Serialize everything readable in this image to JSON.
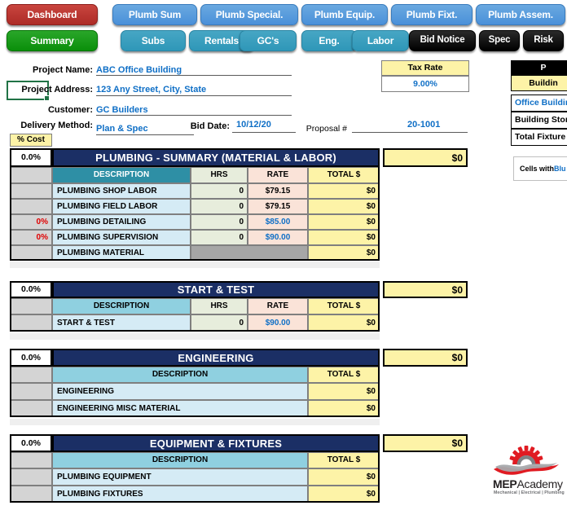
{
  "nav": {
    "row1": [
      {
        "label": "Dashboard",
        "style": "red"
      },
      {
        "label": "Plumb Sum",
        "style": "blue"
      },
      {
        "label": "Plumb Special.",
        "style": "blue"
      },
      {
        "label": "Plumb Equip.",
        "style": "blue"
      },
      {
        "label": "Plumb Fixt.",
        "style": "blue"
      },
      {
        "label": "Plumb Assem.",
        "style": "blue"
      }
    ],
    "row2": [
      {
        "label": "Summary",
        "style": "green"
      },
      {
        "label": "Subs",
        "style": "teal"
      },
      {
        "label": "Rentals",
        "style": "teal"
      },
      {
        "label": "GC's",
        "style": "teal"
      },
      {
        "label": "Eng.",
        "style": "teal"
      },
      {
        "label": "Labor",
        "style": "teal"
      },
      {
        "label": "Bid Notice",
        "style": "black"
      },
      {
        "label": "Spec",
        "style": "black"
      },
      {
        "label": "Risk",
        "style": "black"
      }
    ]
  },
  "project": {
    "name_label": "Project Name:",
    "name_value": "ABC Office Building",
    "address_label": "Project Address:",
    "address_value": "123 Any Street, City, State",
    "customer_label": "Customer:",
    "customer_value": "GC Builders",
    "delivery_label": "Delivery Method:",
    "delivery_value": "Plan & Spec",
    "bid_date_label": "Bid Date:",
    "bid_date_value": "10/12/20",
    "proposal_label": "Proposal #",
    "proposal_value": "20-1001"
  },
  "tax": {
    "header": "Tax Rate",
    "value": "9.00%"
  },
  "pct_cost_label": "% Cost",
  "right_panel": {
    "title": "P",
    "subtitle": "Buildin",
    "rows": [
      {
        "label": "Office Buildin",
        "blue": true
      },
      {
        "label": "Building Stori",
        "blue": false
      },
      {
        "label": "Total Fixture ",
        "blue": false
      }
    ],
    "note_plain": "Cells with ",
    "note_blue": "Blu"
  },
  "sections": [
    {
      "pct": "0.0%",
      "title": "PLUMBING - SUMMARY (MATERIAL & LABOR)",
      "grand_total": "$0",
      "columns": [
        "DESCRIPTION",
        "HRS",
        "RATE",
        "TOTAL $"
      ],
      "has_hrs_rate": true,
      "desc_header_style": "teal",
      "rows": [
        {
          "pct": "",
          "desc": "PLUMBING SHOP LABOR",
          "hrs": "0",
          "rate": "$79.15",
          "rate_blue": false,
          "total": "$0",
          "hrs_blank": false
        },
        {
          "pct": "",
          "desc": "PLUMBING FIELD LABOR",
          "hrs": "0",
          "rate": "$79.15",
          "rate_blue": false,
          "total": "$0",
          "hrs_blank": false
        },
        {
          "pct": "0%",
          "desc": "PLUMBING DETAILING",
          "hrs": "0",
          "rate": "$85.00",
          "rate_blue": true,
          "total": "$0",
          "hrs_blank": false
        },
        {
          "pct": "0%",
          "desc": "PLUMBING SUPERVISION",
          "hrs": "0",
          "rate": "$90.00",
          "rate_blue": true,
          "total": "$0",
          "hrs_blank": false
        },
        {
          "pct": "",
          "desc": "PLUMBING MATERIAL",
          "hrs": "",
          "rate": "",
          "rate_blue": false,
          "total": "$0",
          "hrs_blank": true
        }
      ]
    },
    {
      "pct": "0.0%",
      "title": "START & TEST",
      "grand_total": "$0",
      "columns": [
        "DESCRIPTION",
        "HRS",
        "RATE",
        "TOTAL $"
      ],
      "has_hrs_rate": true,
      "desc_header_style": "ltblue",
      "rows": [
        {
          "pct": "",
          "desc": "START & TEST",
          "hrs": "0",
          "rate": "$90.00",
          "rate_blue": true,
          "total": "$0",
          "hrs_blank": false
        }
      ]
    },
    {
      "pct": "0.0%",
      "title": "ENGINEERING",
      "grand_total": "$0",
      "columns": [
        "DESCRIPTION",
        "TOTAL $"
      ],
      "has_hrs_rate": false,
      "desc_header_style": "ltblue",
      "rows": [
        {
          "pct": "",
          "desc": "ENGINEERING",
          "total": "$0"
        },
        {
          "pct": "",
          "desc": "ENGINEERING MISC MATERIAL",
          "total": "$0"
        }
      ]
    },
    {
      "pct": "0.0%",
      "title": "EQUIPMENT & FIXTURES",
      "grand_total": "$0",
      "columns": [
        "DESCRIPTION",
        "TOTAL $"
      ],
      "has_hrs_rate": false,
      "desc_header_style": "ltblue",
      "rows": [
        {
          "pct": "",
          "desc": "PLUMBING EQUIPMENT",
          "total": "$0"
        },
        {
          "pct": "",
          "desc": "PLUMBING FIXTURES",
          "total": "$0"
        }
      ]
    }
  ],
  "logo": {
    "name_bold": "MEP",
    "name_light": "Academy",
    "tagline": "Mechanical | Electrical | Plumbing"
  },
  "colors": {
    "navy": "#1b2f65",
    "teal": "#2e8fa5",
    "light_blue": "#8fd0e0",
    "pale_blue": "#d5ebf5",
    "yellow": "#fdf3a7",
    "blue_text": "#0f6fc6",
    "red_text": "#e00000",
    "logo_red": "#e01b22"
  }
}
